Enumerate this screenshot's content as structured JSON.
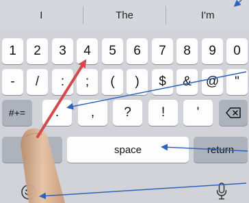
{
  "suggestions": [
    "I",
    "The",
    "I'm"
  ],
  "row1": [
    "1",
    "2",
    "3",
    "4",
    "5",
    "6",
    "7",
    "8",
    "9",
    "0"
  ],
  "row2": [
    "-",
    "/",
    ":",
    ";",
    "(",
    ")",
    "$",
    "&",
    "@",
    "\""
  ],
  "row3": {
    "mode_label": "#+=",
    "keys": [
      ".",
      ",",
      "?",
      "!",
      "'"
    ],
    "delete_icon": "backspace-icon"
  },
  "row4": {
    "space_label": "space",
    "return_label": "return"
  },
  "bottom": {
    "emoji_icon": "emoji-icon",
    "mic_icon": "microphone-icon"
  },
  "colors": {
    "keyboard_bg": "#d1d3d9",
    "key": "#fdfdfd",
    "dark_key": "#adb3bc",
    "arrow_blue": "#2d63b8",
    "arrow_red": "#d24a4a"
  }
}
